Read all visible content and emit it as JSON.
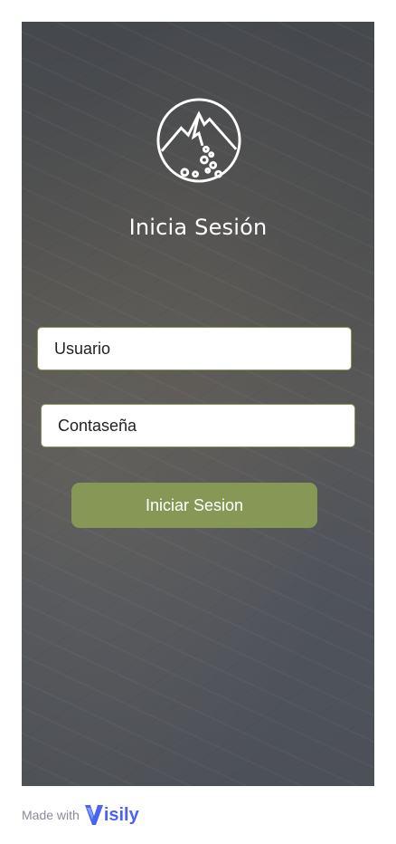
{
  "login": {
    "title": "Inicia Sesión",
    "logo_icon": "mountain-logo-icon",
    "username_placeholder": "Usuario",
    "password_placeholder": "Contaseña",
    "submit_label": "Iniciar Sesion"
  },
  "colors": {
    "button": "#879856",
    "field_border": "#8a9a5b",
    "brand": "#4a63f5"
  },
  "footer": {
    "made_with": "Made with",
    "brand": "isily"
  }
}
